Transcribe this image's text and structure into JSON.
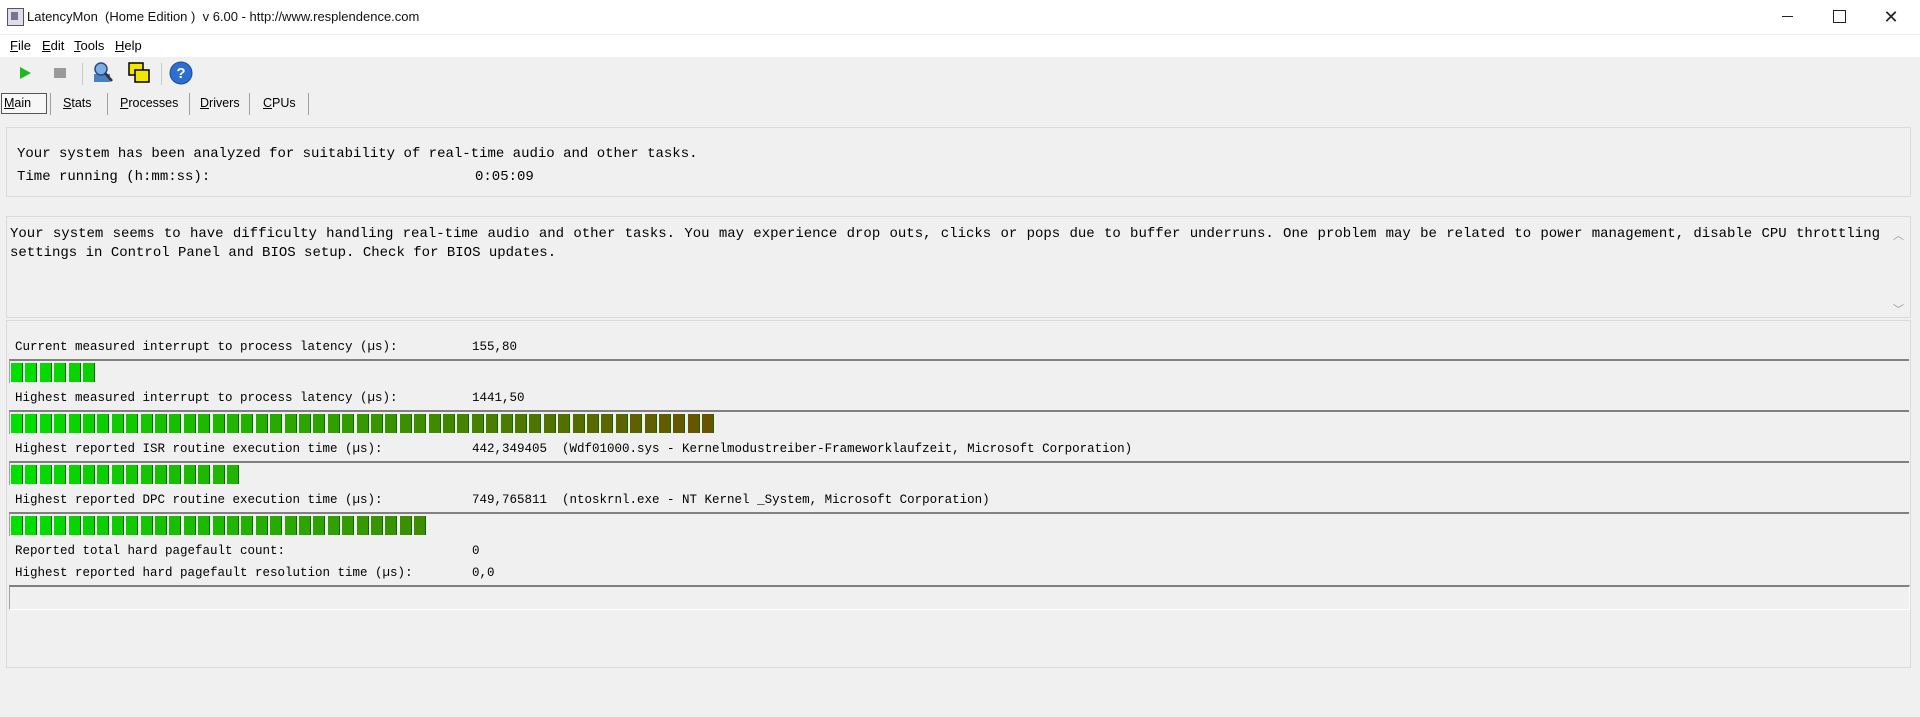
{
  "window": {
    "title": "LatencyMon  (Home Edition )  v 6.00 - http://www.resplendence.com",
    "minimize": "—",
    "close": "✕"
  },
  "menu": [
    {
      "underline": "F",
      "rest": "ile"
    },
    {
      "underline": "E",
      "rest": "dit"
    },
    {
      "underline": "T",
      "rest": "ools"
    },
    {
      "underline": "H",
      "rest": "elp"
    }
  ],
  "toolbar": {
    "icons": [
      "play-icon",
      "stop-icon",
      "analyze-icon",
      "windows-icon",
      "help-icon"
    ],
    "help_glyph": "?"
  },
  "tabs": [
    {
      "underline": "M",
      "rest": "ain",
      "active": true
    },
    {
      "underline": "S",
      "rest": "tats",
      "active": false
    },
    {
      "underline": "P",
      "rest": "rocesses",
      "active": false
    },
    {
      "underline": "D",
      "rest": "rivers",
      "active": false
    },
    {
      "underline": "C",
      "rest": "PUs",
      "active": false
    }
  ],
  "summary": {
    "line1": "Your system has been analyzed for suitability of real-time audio and other tasks.",
    "time_label": "Time running (h:mm:ss):",
    "time_value": "0:05:09"
  },
  "conclusion": "Your system seems to have difficulty handling real-time audio and other tasks. You may experience drop outs, clicks or pops due to buffer underruns. One problem may be related to power management, disable CPU throttling settings in Control Panel and BIOS setup. Check for BIOS updates.",
  "metrics": [
    {
      "label": "Current measured interrupt to process latency (µs):",
      "value": "155,80",
      "detail": "",
      "bar_level": 0.047
    },
    {
      "label": "Highest measured interrupt to process latency (µs):",
      "value": "1441,50",
      "detail": "",
      "bar_level": 0.37
    },
    {
      "label": "Highest reported ISR routine execution time (µs):",
      "value": "442,349405",
      "detail": "(Wdf01000.sys - Kernelmodustreiber-Frameworklaufzeit, Microsoft Corporation)",
      "bar_level": 0.123
    },
    {
      "label": "Highest reported DPC routine execution time (µs):",
      "value": "749,765811",
      "detail": "(ntoskrnl.exe - NT Kernel _System, Microsoft Corporation)",
      "bar_level": 0.218
    },
    {
      "label": "Reported total hard pagefault count:",
      "value": "0",
      "detail": "",
      "bar_level": null
    },
    {
      "label": "Highest reported hard pagefault resolution time (µs):",
      "value": "0,0",
      "detail": "",
      "bar_level": 0
    }
  ],
  "colors": {
    "bar_start": "#00e000",
    "bar_end": "#6b5000",
    "seg_border": "#0a6a0a"
  }
}
